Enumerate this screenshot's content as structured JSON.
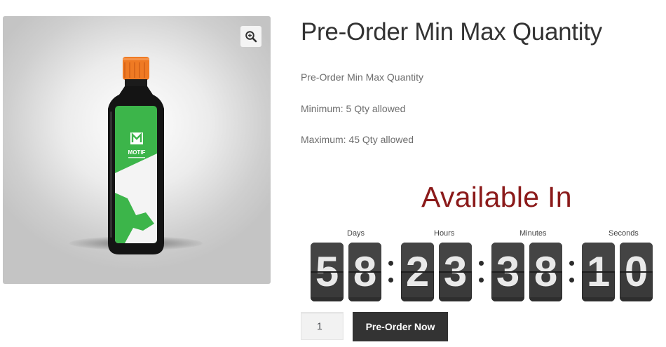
{
  "product": {
    "title": "Pre-Order Min Max Quantity",
    "description": [
      "Pre-Order Min Max Quantity",
      "Minimum: 5 Qty allowed",
      "Maximum: 45 Qty allowed"
    ],
    "image": {
      "brand_text": "MOTIF",
      "zoom_icon": "magnifier-plus-icon"
    }
  },
  "countdown": {
    "heading": "Available In",
    "units": [
      {
        "label": "Days",
        "digits": [
          "5",
          "8"
        ]
      },
      {
        "label": "Hours",
        "digits": [
          "2",
          "3"
        ]
      },
      {
        "label": "Minutes",
        "digits": [
          "3",
          "8"
        ]
      },
      {
        "label": "Seconds",
        "digits": [
          "1",
          "0"
        ]
      }
    ],
    "heading_color": "#8b1a1a"
  },
  "cart": {
    "quantity": "1",
    "button_label": "Pre-Order Now"
  },
  "colors": {
    "bottle_green": "#3cb54a",
    "cap_orange": "#ef7a23",
    "button_bg": "#333333"
  }
}
